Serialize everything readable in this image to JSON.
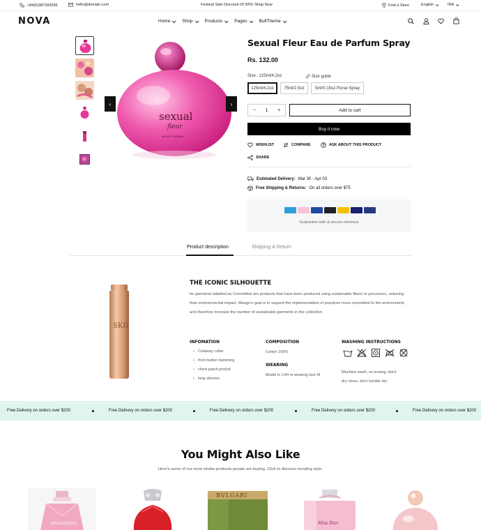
{
  "topbar": {
    "phone": "+84(0)387392056",
    "email": "hello@domain.com",
    "promo": "Festival Sale Discount Of 30%! Shop Now",
    "store": "Find a Store",
    "language": "English",
    "currency": "INR"
  },
  "header": {
    "logo": "NOVA",
    "nav": [
      {
        "label": "Home"
      },
      {
        "label": "Shop"
      },
      {
        "label": "Products"
      },
      {
        "label": "Pages"
      },
      {
        "label": "BullTheme"
      }
    ]
  },
  "product": {
    "title": "Sexual Fleur Eau de Parfum Spray",
    "price": "Rs. 132.00",
    "size_label": "Size : 125ml/4.2oz",
    "size_guide": "Size guide",
    "sizes": [
      "125ml/4.2oz",
      "75ml/2.5oz",
      "5ml/0.15oz Purse Spray"
    ],
    "selected_size": "125ml/4.2oz",
    "bottle_text_1": "sexual",
    "bottle_text_2": "fleur",
    "bottle_text_3": "MICHEL GERMAIN",
    "qty": "1",
    "qty_minus": "−",
    "qty_plus": "+",
    "add_to_cart": "Add to cart",
    "buy_now": "Buy it now",
    "actions": {
      "wishlist": "WISHLIST",
      "compare": "COMPARE",
      "ask": "ASK ABOUT THIS PRODUCT",
      "share": "SHARE"
    },
    "delivery_label": "Estimated Delivery:",
    "delivery_value": "Mar 30 - Apr 03",
    "shipping_label": "Free Shipping & Returns:",
    "shipping_value": "On all orders over $75",
    "payment_icons": [
      "amex",
      "klarna",
      "bank",
      "mastercard",
      "paypal-yellow",
      "visa",
      "paypal"
    ],
    "guarantee": "Guarantee safe & secure checkout"
  },
  "tabs": [
    "Product description",
    "Shipping & Return"
  ],
  "description": {
    "heading": "THE ICONIC SILHOUETTE",
    "paragraph": "he garments labelled as Committed are products that have been produced using sustainable fibers or processes, reducing their environmental impact. Mango's goal is to support the implementation of practices more committed to the environment, and therefore increase the number of sustainable garments in the collection.",
    "info_heading": "INFOMATION",
    "info_items": [
      "Cutaway collar",
      "front button fastening",
      "chest patch pocket",
      "long sleeves"
    ],
    "composition_heading": "COMPOSITION",
    "composition": "Cotton 100%",
    "wearing_heading": "WEARING",
    "wearing": "Model is 1.84 m wearing size M",
    "washing_heading": "WASHING INSTRUCTIONS",
    "washing_line1": "Machine wash, no ironing, don't",
    "washing_line2": "dry clean, don't tumble dry",
    "bottle_label": "SKII"
  },
  "marquee": {
    "text": "Free Delivery on orders over $200"
  },
  "recommend": {
    "title": "You Might Also Like",
    "subtitle": "Here's some of our most similar products people are buying. Click to discover trending style.",
    "card_labels": [
      "IRRESISTIBLE",
      "BVLGARI",
      "Miss Dior"
    ]
  },
  "colors": {
    "accent": "#111111",
    "marquee_bg": "#e0f5ee",
    "perfume_pink": "#e8389a"
  }
}
